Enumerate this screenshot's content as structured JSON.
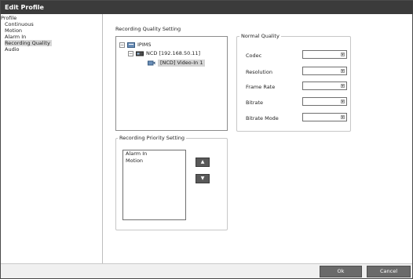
{
  "window": {
    "title": "Edit Profile"
  },
  "sidebar": {
    "items": [
      {
        "label": "Profile"
      },
      {
        "label": "Continuous"
      },
      {
        "label": "Motion"
      },
      {
        "label": "Alarm In"
      },
      {
        "label": "Recording Quality"
      },
      {
        "label": "Audio"
      }
    ]
  },
  "recording_quality": {
    "title": "Recording Quality Setting",
    "tree": {
      "root": "IPIMS",
      "child": "NCD [192.168.50.11]",
      "leaf": "[NCD] Video-In 1"
    }
  },
  "normal_quality": {
    "label": "Normal Quality",
    "fields": [
      {
        "label": "Codec",
        "value": ""
      },
      {
        "label": "Resolution",
        "value": ""
      },
      {
        "label": "Frame Rate",
        "value": ""
      },
      {
        "label": "Bitrate",
        "value": ""
      },
      {
        "label": "Bitrate Mode",
        "value": ""
      }
    ]
  },
  "priority": {
    "label": "Recording Priority Setting",
    "items": [
      "Alarm In",
      "Motion"
    ],
    "up_symbol": "▲",
    "down_symbol": "▼"
  },
  "icons": {
    "expander_minus": "⊟",
    "dropdown_arrow": "▾"
  },
  "footer": {
    "ok_label": "Ok",
    "cancel_label": "Cancel"
  }
}
